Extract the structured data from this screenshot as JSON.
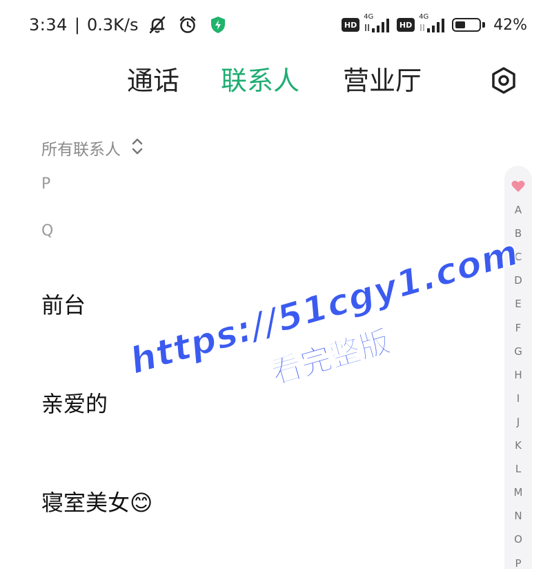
{
  "status_bar": {
    "time": "3:34",
    "separator": "|",
    "speed": "0.3K/s",
    "hd1": "HD",
    "net1": "4G",
    "hd2": "HD",
    "net2": "4G",
    "battery_percent": "42%",
    "battery_level": 0.42,
    "icons": [
      "bell-off-icon",
      "alarm-icon",
      "shield-icon",
      "signal-icon",
      "battery-icon"
    ]
  },
  "tabs": [
    {
      "label": "通话",
      "active": false
    },
    {
      "label": "联系人",
      "active": true
    },
    {
      "label": "营业厅",
      "active": false
    }
  ],
  "settings_icon": "hexagon-settings-icon",
  "filter": {
    "label": "所有联系人",
    "icon": "sort-chevrons-icon"
  },
  "sections": [
    {
      "letter": "P"
    },
    {
      "letter": "Q"
    }
  ],
  "contacts": [
    {
      "name": "前台"
    },
    {
      "name": "亲爱的"
    },
    {
      "name": "寝室美女😊"
    }
  ],
  "index": {
    "favorite_icon": "heart-icon",
    "letters": [
      "A",
      "B",
      "C",
      "D",
      "E",
      "F",
      "G",
      "H",
      "I",
      "J",
      "K",
      "L",
      "M",
      "N",
      "O",
      "P"
    ]
  },
  "watermark": {
    "line1": "https://51cgy1.com",
    "line2": "看完整版"
  },
  "colors": {
    "accent": "#1fad72",
    "watermark": "#3b5bf0",
    "heart": "#f28ca0"
  }
}
